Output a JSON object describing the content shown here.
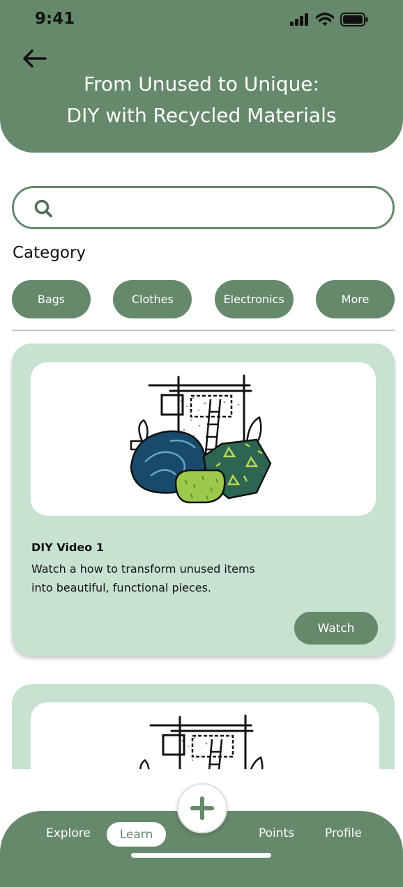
{
  "status_bar": {
    "time": "9:41"
  },
  "header": {
    "title_line1": "From Unused to Unique:",
    "title_line2": "DIY with Recycled Materials"
  },
  "search": {
    "value": "",
    "placeholder": ""
  },
  "category": {
    "title": "Category",
    "chips": [
      "Bags",
      "Clothes",
      "Electronics",
      "More"
    ]
  },
  "cards": [
    {
      "title": "DIY Video 1",
      "description": "Watch a how to transform unused items into beautiful, functional pieces.",
      "button": "Watch"
    }
  ],
  "bottom_nav": {
    "items": [
      "Explore",
      "Learn",
      "Points",
      "Profile"
    ],
    "active": "Learn"
  },
  "colors": {
    "primary": "#66886b",
    "card_bg": "#c8e2d2",
    "navy": "#174a6b",
    "teal": "#2d6650",
    "lime": "#9cc94b"
  },
  "icons": [
    "back-arrow-icon",
    "search-icon",
    "plus-icon",
    "signal-icon",
    "wifi-icon",
    "battery-icon"
  ]
}
